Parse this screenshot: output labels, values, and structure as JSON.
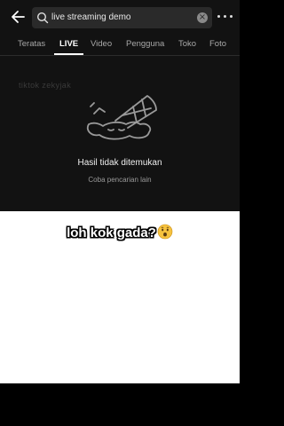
{
  "search": {
    "query": "live streaming demo"
  },
  "tabs": [
    {
      "label": "Teratas"
    },
    {
      "label": "LIVE"
    },
    {
      "label": "Video"
    },
    {
      "label": "Pengguna"
    },
    {
      "label": "Toko"
    },
    {
      "label": "Foto"
    }
  ],
  "active_tab": "LIVE",
  "watermark": "tiktok  zekyjak",
  "empty_state": {
    "title": "Hasil tidak ditemukan",
    "subtitle": "Coba pencarian lain",
    "illustration": "melted-ice-cream"
  },
  "caption": {
    "text": "loh kok gada?",
    "emoji": "astonished-face"
  },
  "colors": {
    "app_background": "#121212",
    "search_background": "#2a2a2a",
    "caption_background": "#ffffff",
    "emoji_yellow": "#f6c23e"
  }
}
